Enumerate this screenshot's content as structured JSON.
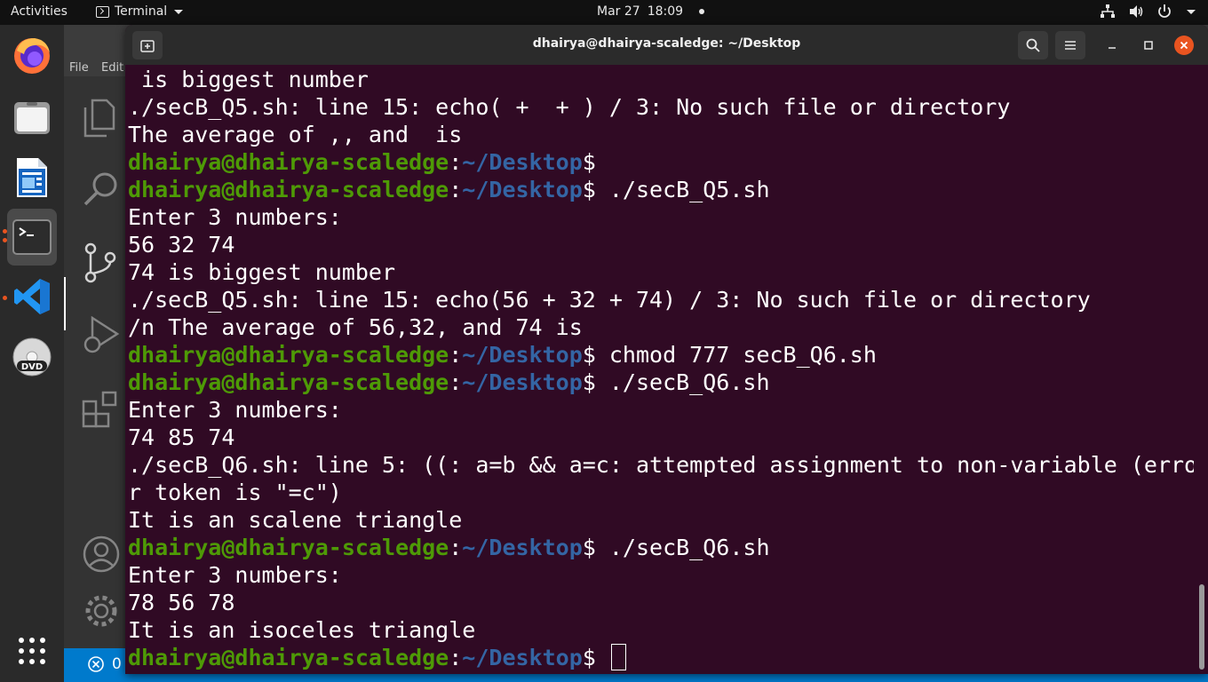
{
  "topbar": {
    "activities": "Activities",
    "app_name": "Terminal",
    "date": "Mar 27",
    "time": "18:09"
  },
  "dock": {
    "items": [
      {
        "name": "firefox",
        "icon": "firefox-icon"
      },
      {
        "name": "files",
        "icon": "folder-icon"
      },
      {
        "name": "writer",
        "icon": "document-icon"
      },
      {
        "name": "terminal",
        "icon": "terminal-icon"
      },
      {
        "name": "vscode",
        "icon": "vscode-icon"
      },
      {
        "name": "dvd",
        "icon": "dvd-icon"
      },
      {
        "name": "apps",
        "icon": "grid-icon"
      }
    ]
  },
  "vscode": {
    "menu_file": "File",
    "menu_edit": "Edit",
    "status_errors": "0"
  },
  "terminal": {
    "title": "dhairya@dhairya-scaledge: ~/Desktop",
    "user_host": "dhairya@dhairya-scaledge",
    "path": "~/Desktop",
    "lines": [
      {
        "type": "out",
        "text": " is biggest number"
      },
      {
        "type": "out",
        "text": "./secB_Q5.sh: line 15: echo( +  + ) / 3: No such file or directory"
      },
      {
        "type": "out",
        "text": "The average of ,, and  is"
      },
      {
        "type": "prompt",
        "cmd": ""
      },
      {
        "type": "prompt",
        "cmd": " ./secB_Q5.sh"
      },
      {
        "type": "out",
        "text": "Enter 3 numbers:"
      },
      {
        "type": "out",
        "text": "56 32 74"
      },
      {
        "type": "out",
        "text": "74 is biggest number"
      },
      {
        "type": "out",
        "text": "./secB_Q5.sh: line 15: echo(56 + 32 + 74) / 3: No such file or directory"
      },
      {
        "type": "out",
        "text": "/n The average of 56,32, and 74 is"
      },
      {
        "type": "prompt",
        "cmd": " chmod 777 secB_Q6.sh"
      },
      {
        "type": "prompt",
        "cmd": " ./secB_Q6.sh"
      },
      {
        "type": "out",
        "text": "Enter 3 numbers:"
      },
      {
        "type": "out",
        "text": "74 85 74"
      },
      {
        "type": "out",
        "text": "./secB_Q6.sh: line 5: ((: a=b && a=c: attempted assignment to non-variable (erro"
      },
      {
        "type": "out",
        "text": "r token is \"=c\")"
      },
      {
        "type": "out",
        "text": "It is an scalene triangle"
      },
      {
        "type": "prompt",
        "cmd": " ./secB_Q6.sh"
      },
      {
        "type": "out",
        "text": "Enter 3 numbers:"
      },
      {
        "type": "out",
        "text": "78 56 78"
      },
      {
        "type": "out",
        "text": "It is an isoceles triangle"
      },
      {
        "type": "prompt",
        "cmd": " ",
        "cursor": true
      }
    ]
  },
  "colors": {
    "terminal_bg": "#300a24",
    "user_green": "#4e9a06",
    "path_blue": "#3465a4",
    "close_orange": "#e95420",
    "vscode_status": "#007acc"
  }
}
